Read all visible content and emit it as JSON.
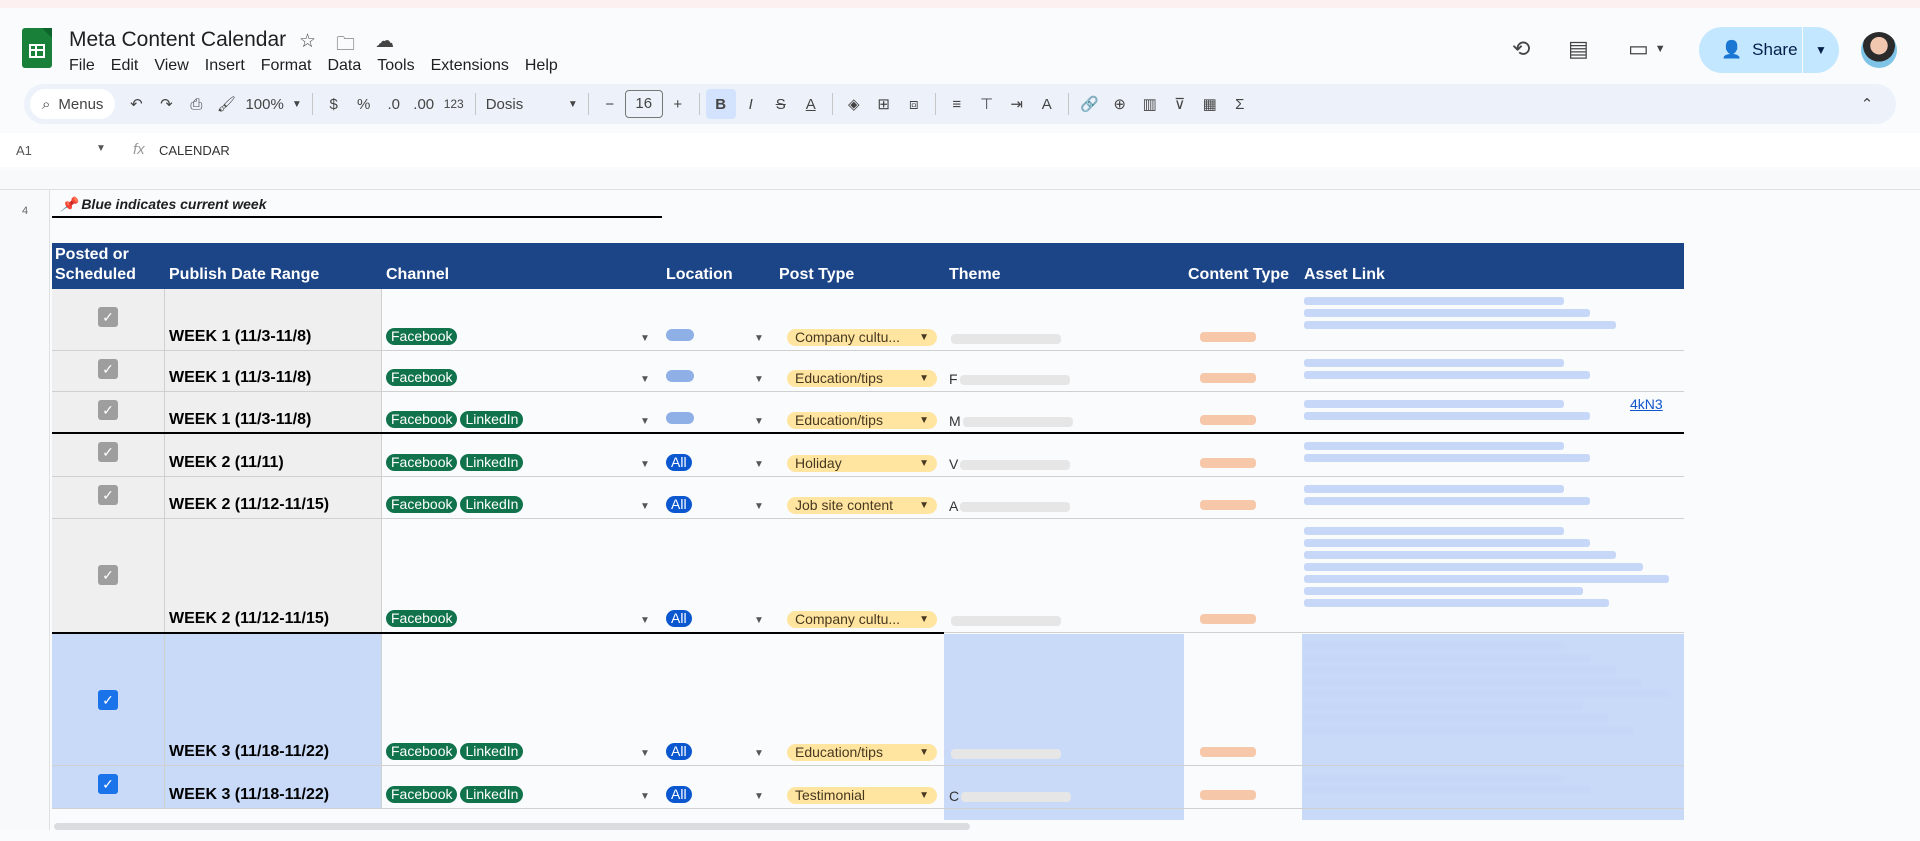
{
  "app": {
    "title": "Meta Content Calendar"
  },
  "menu": [
    "File",
    "Edit",
    "View",
    "Insert",
    "Format",
    "Data",
    "Tools",
    "Extensions",
    "Help"
  ],
  "share": {
    "label": "Share"
  },
  "toolbar": {
    "search": "Menus",
    "zoom": "100%",
    "currency": "$",
    "percent": "%",
    "dec_decrease": ".0",
    "dec_increase": ".00",
    "number_format": "123",
    "font": "Dosis",
    "font_size": "16"
  },
  "formula_bar": {
    "cell_ref": "A1",
    "fx": "fx",
    "value": "CALENDAR"
  },
  "sheet": {
    "note": "📌 Blue indicates current week",
    "headers": [
      "Posted or Scheduled",
      "Publish Date Range",
      "Channel",
      "Location",
      "Post Type",
      "Theme",
      "Content Type",
      "Asset Link"
    ],
    "rows": [
      {
        "week": "WEEK 1 (11/3-11/8)",
        "channels": [
          "Facebook"
        ],
        "location": "",
        "post_type": "Company cultu...",
        "theme": ""
      },
      {
        "week": "WEEK 1 (11/3-11/8)",
        "channels": [
          "Facebook"
        ],
        "location": "",
        "post_type": "Education/tips",
        "theme": "F"
      },
      {
        "week": "WEEK 1 (11/3-11/8)",
        "channels": [
          "Facebook",
          "LinkedIn"
        ],
        "location": "",
        "post_type": "Education/tips",
        "theme": "M"
      },
      {
        "week": "WEEK 2 (11/11)",
        "channels": [
          "Facebook",
          "LinkedIn"
        ],
        "location": "All",
        "post_type": "Holiday",
        "theme": "V"
      },
      {
        "week": "WEEK 2 (11/12-11/15)",
        "channels": [
          "Facebook",
          "LinkedIn"
        ],
        "location": "All",
        "post_type": "Job site content",
        "theme": "A"
      },
      {
        "week": "WEEK 2 (11/12-11/15)",
        "channels": [
          "Facebook"
        ],
        "location": "All",
        "post_type": "Company cultu...",
        "theme": ""
      },
      {
        "week": "WEEK 3 (11/18-11/22)",
        "channels": [
          "Facebook",
          "LinkedIn"
        ],
        "location": "All",
        "post_type": "Education/tips",
        "theme": ""
      },
      {
        "week": "WEEK 3 (11/18-11/22)",
        "channels": [
          "Facebook",
          "LinkedIn"
        ],
        "location": "All",
        "post_type": "Testimonial",
        "theme": "C"
      }
    ],
    "asset_fragment": "4kN3"
  },
  "colors": {
    "header_bg": "#1c4587",
    "current_week": "#c9daf8",
    "channel_chip": "#11734b",
    "location_chip": "#0b57d0",
    "post_type_chip": "#ffe5a0",
    "share_bg": "#c2e7ff"
  }
}
